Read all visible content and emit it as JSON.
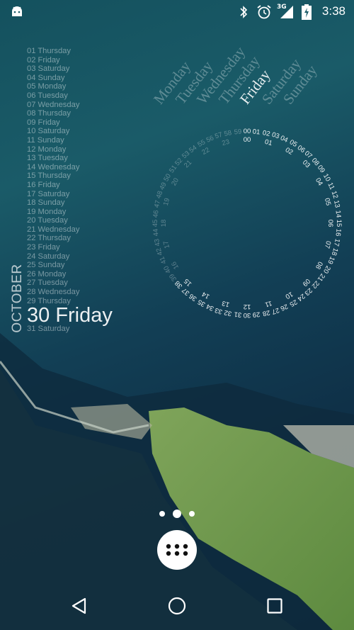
{
  "status_bar": {
    "time": "3:38",
    "icons": [
      "android-notification-icon",
      "bluetooth-icon",
      "alarm-icon",
      "signal-3g-icon",
      "battery-charging-icon"
    ],
    "network_label": "3G"
  },
  "calendar": {
    "month": "OCTOBER",
    "today_index": 29,
    "days": [
      "01 Thursday",
      "02 Friday",
      "03 Saturday",
      "04 Sunday",
      "05 Monday",
      "06 Tuesday",
      "07 Wednesday",
      "08 Thursday",
      "09 Friday",
      "10 Saturday",
      "11 Sunday",
      "12 Monday",
      "13 Tuesday",
      "14 Wednesday",
      "15 Thursday",
      "16 Friday",
      "17 Saturday",
      "18 Sunday",
      "19 Monday",
      "20 Tuesday",
      "21 Wednesday",
      "22 Thursday",
      "23 Friday",
      "24 Saturday",
      "25 Sunday",
      "26 Monday",
      "27 Tuesday",
      "28 Wednesday",
      "29 Thursday",
      "30 Friday",
      "31 Saturday"
    ]
  },
  "weekdays": {
    "items": [
      "Monday",
      "Tuesday",
      "Wednesday",
      "Thursday",
      "Friday",
      "Saturday",
      "Sunday"
    ],
    "current_index": 4
  },
  "clock": {
    "hour": 15,
    "minute": 38,
    "hour_count": 24,
    "minute_count": 60
  },
  "home": {
    "page_count": 3,
    "current_page": 1,
    "app_drawer_icon": "apps-grid-icon"
  },
  "nav_bar": {
    "icons": [
      "back-icon",
      "home-icon",
      "recents-icon"
    ]
  },
  "colors": {
    "water": "#14515e",
    "land": "#6f9a4a",
    "text": "#ffffff"
  }
}
